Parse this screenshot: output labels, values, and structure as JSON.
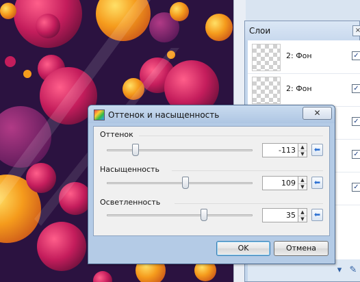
{
  "layers_panel": {
    "title": "Слои",
    "close_icon": "×",
    "layers": [
      {
        "name": "2: Фон",
        "visible": true
      },
      {
        "name": "2: Фон",
        "visible": true
      },
      {
        "name": "",
        "visible": true
      },
      {
        "name": "",
        "visible": true
      },
      {
        "name": "",
        "visible": true
      }
    ],
    "toolbar_icons": [
      "properties-icon",
      "brush-icon"
    ]
  },
  "dialog": {
    "title": "Оттенок и насыщенность",
    "close_icon": "✕",
    "hue": {
      "label": "Оттенок",
      "value": "-113",
      "min": -180,
      "max": 180
    },
    "saturation": {
      "label": "Насыщенность",
      "value": "109",
      "min": 0,
      "max": 200
    },
    "lightness": {
      "label": "Осветленность",
      "value": "35",
      "min": -100,
      "max": 100
    },
    "reset_icon": "⬅",
    "ok_label": "OK",
    "cancel_label": "Отмена"
  },
  "colors": {
    "accent": "#2a6fd1",
    "canvas_dark": "#1f0c2e",
    "bubble_orange": "#f59b1c",
    "bubble_magenta": "#c41d5c"
  }
}
